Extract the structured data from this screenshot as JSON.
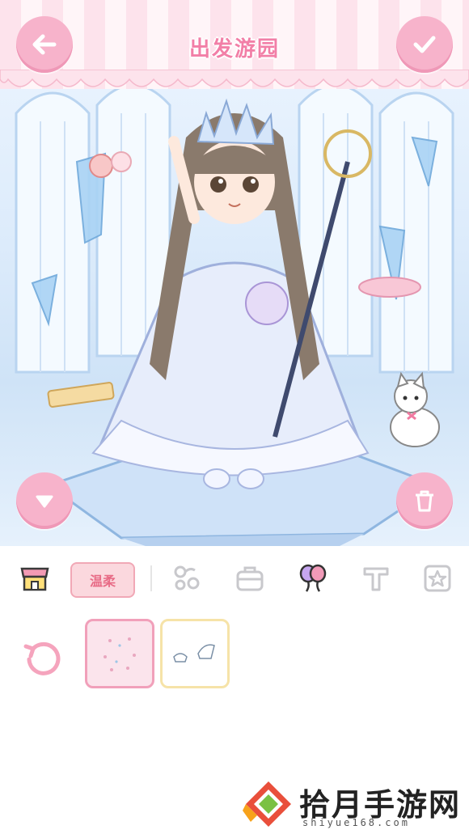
{
  "header": {
    "title": "出发游园"
  },
  "buttons": {
    "back": "back-arrow-icon",
    "confirm": "checkmark-icon",
    "collapse": "chevron-down-icon",
    "delete": "trash-icon"
  },
  "toolbar": {
    "tag_label": "温柔",
    "tabs": [
      "shop-icon",
      "flower-icon",
      "bag-icon",
      "balloon-icon",
      "text-icon",
      "star-frame-icon"
    ]
  },
  "items": [
    "decoration-item-1",
    "decoration-item-2"
  ],
  "watermark": {
    "title": "拾月手游网",
    "url": "shiyue168.com"
  },
  "colors": {
    "accent": "#f7b3cb",
    "title": "#f27fa7",
    "tag_bg": "#fbd8de"
  }
}
